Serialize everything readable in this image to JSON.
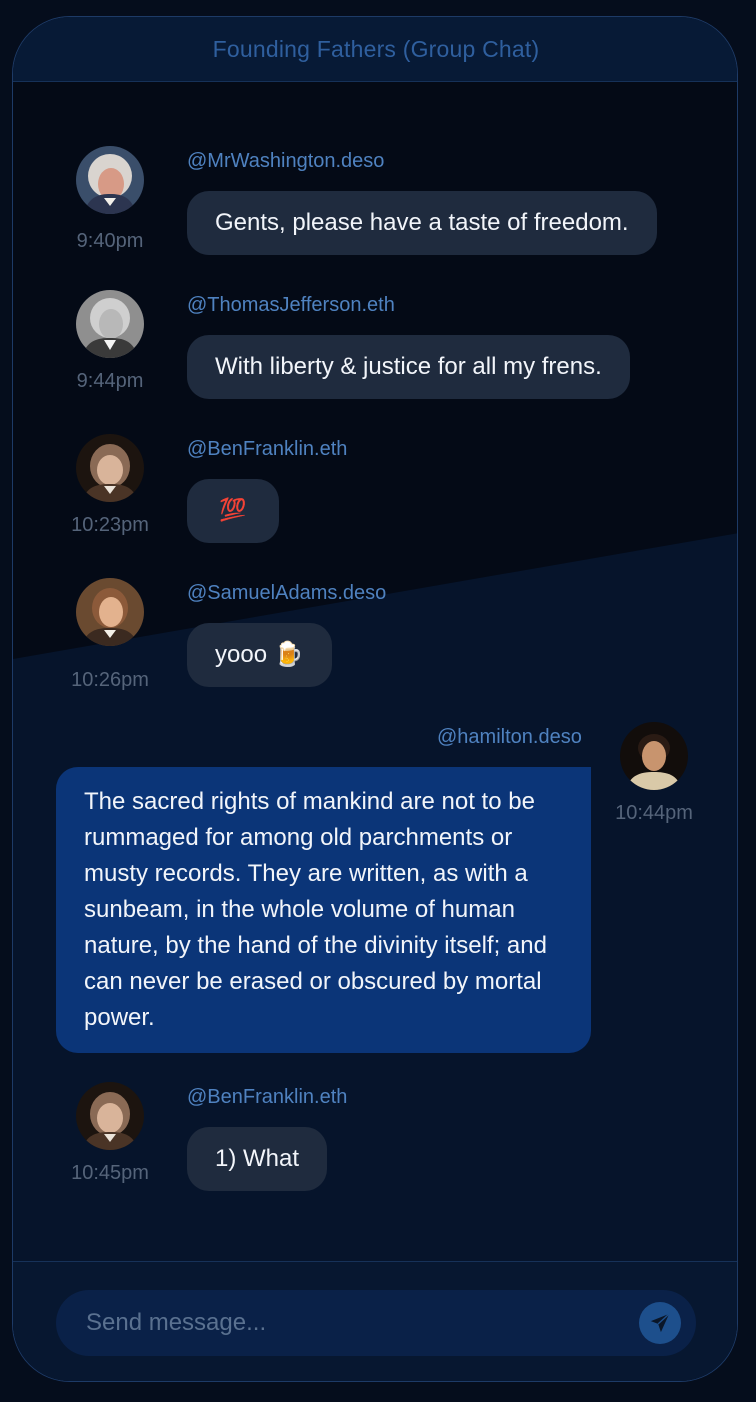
{
  "header": {
    "title": "Founding Fathers (Group Chat)"
  },
  "messages": [
    {
      "handle": "@MrWashington.deso",
      "text": "Gents, please have a taste of freedom.",
      "time": "9:40pm",
      "avatar": "george-washington-portrait"
    },
    {
      "handle": "@ThomasJefferson.eth",
      "text": "With liberty & justice for all my frens.",
      "time": "9:44pm",
      "avatar": "thomas-jefferson-portrait"
    },
    {
      "handle": "@BenFranklin.eth",
      "text": "💯",
      "time": "10:23pm",
      "avatar": "ben-franklin-portrait"
    },
    {
      "handle": "@SamuelAdams.deso",
      "text": "yooo 🍺",
      "time": "10:26pm",
      "avatar": "samuel-adams-portrait"
    },
    {
      "handle": "@hamilton.deso",
      "text": "The sacred rights of mankind are not to be rummaged for among old parchments or musty records. They are written, as with a sunbeam, in the whole volume of human nature, by the hand of the divinity itself; and can never be erased or obscured by mortal power.",
      "time": "10:44pm",
      "avatar": "hamilton-portrait",
      "mine": true
    },
    {
      "handle": "@BenFranklin.eth",
      "text": "1) What",
      "time": "10:45pm",
      "avatar": "ben-franklin-portrait"
    }
  ],
  "composer": {
    "placeholder": "Send message...",
    "send_icon": "paper-plane-icon"
  },
  "colors": {
    "background": "#050d1c",
    "header": "#071a36",
    "bubble_other": "#1f2b3e",
    "bubble_mine": "#0b3578",
    "handle": "#4f82c0",
    "timestamp": "#55647a"
  }
}
